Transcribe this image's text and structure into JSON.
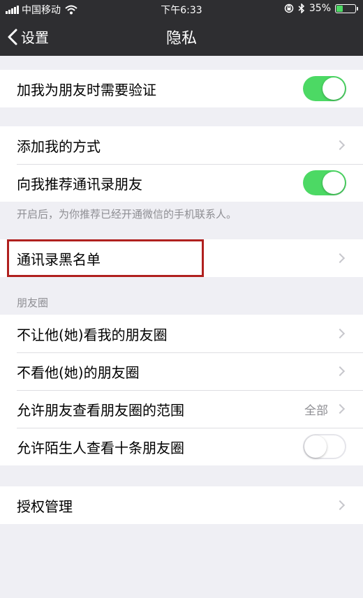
{
  "status_bar": {
    "carrier": "中国移动",
    "time": "下午6:33",
    "battery_percent": "35%",
    "battery_level": 0.35
  },
  "nav": {
    "back_label": "设置",
    "title": "隐私"
  },
  "groups": {
    "verify": {
      "label": "加我为朋友时需要验证",
      "toggle_on": true
    },
    "add_method": {
      "label": "添加我的方式"
    },
    "recommend": {
      "label": "向我推荐通讯录朋友",
      "toggle_on": true
    },
    "recommend_note": "开启后，为你推荐已经开通微信的手机联系人。",
    "blacklist": {
      "label": "通讯录黑名单"
    },
    "moments_header": "朋友圈",
    "moments": {
      "not_let_see": "不让他(她)看我的朋友圈",
      "not_see": "不看他(她)的朋友圈",
      "range": "允许朋友查看朋友圈的范围",
      "range_value": "全部",
      "stranger": "允许陌生人查看十条朋友圈",
      "stranger_toggle_on": false
    },
    "auth": {
      "label": "授权管理"
    }
  },
  "colors": {
    "nav_bg": "#2e2e31",
    "page_bg": "#efeff4",
    "toggle_on": "#4cd964",
    "highlight": "#b0201e"
  },
  "icons": {
    "back": "chevron-left-icon",
    "chevron": "chevron-right-icon",
    "wifi": "wifi-icon",
    "bluetooth": "bluetooth-icon",
    "lock_rotation": "rotation-lock-icon",
    "battery": "battery-icon"
  }
}
